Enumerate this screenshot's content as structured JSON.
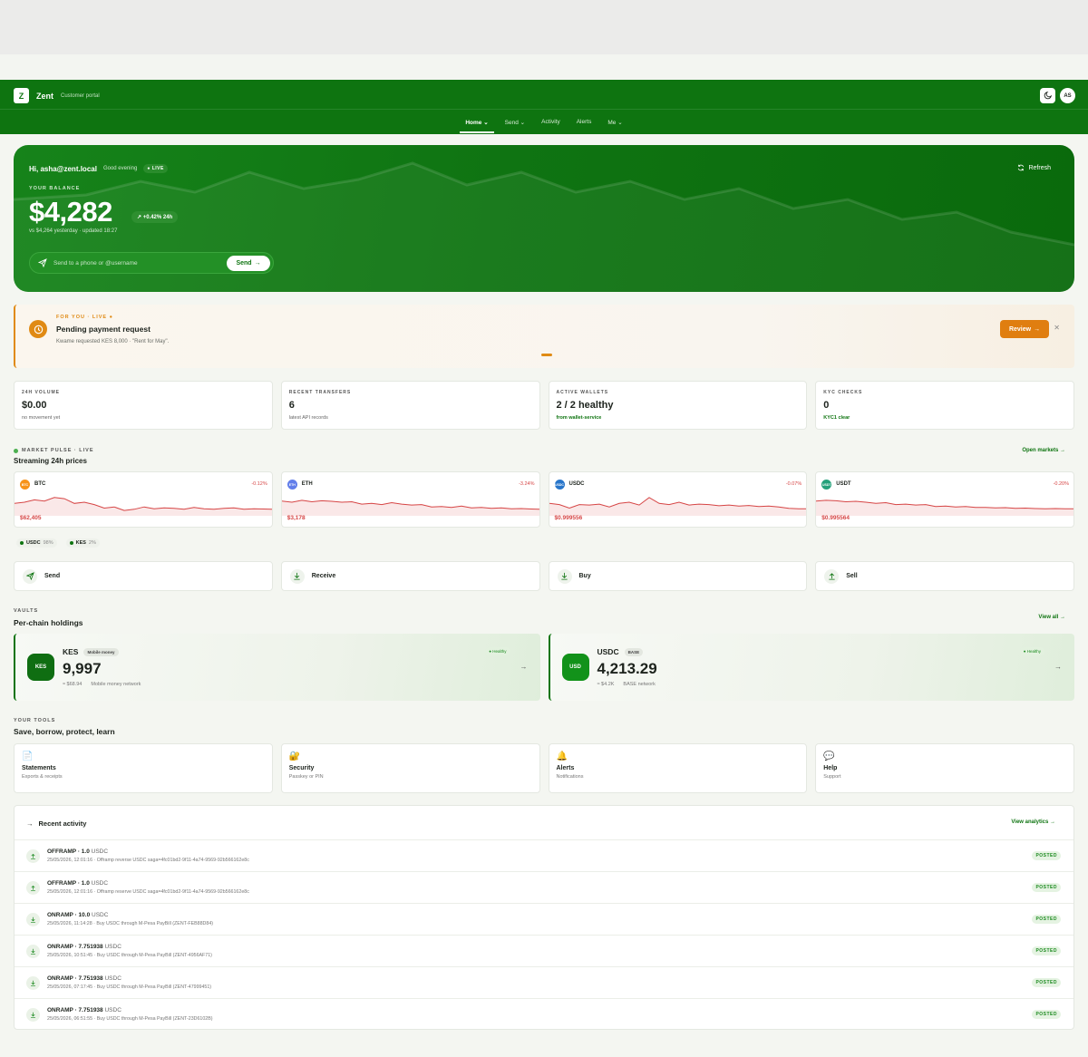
{
  "header": {
    "logo_letter": "Z",
    "brand": "Zent",
    "subtitle": "Customer portal",
    "avatar": "AS",
    "nav": [
      {
        "label": "Home",
        "caret": "⌄"
      },
      {
        "label": "Send",
        "caret": "⌄"
      },
      {
        "label": "Activity",
        "caret": ""
      },
      {
        "label": "Alerts",
        "caret": ""
      },
      {
        "label": "Me",
        "caret": "⌄"
      }
    ]
  },
  "hero": {
    "greeting": "Hi, asha@zent.local",
    "time_of_day": "Good evening",
    "live": "● LIVE",
    "refresh": "Refresh",
    "balance_label": "YOUR BALANCE",
    "balance": "$4,282",
    "change": "↗ +0.42% 24h",
    "meta": "vs $4,264 yesterday · updated 18:27",
    "send_placeholder": "Send to a phone or @username",
    "send_button": "Send"
  },
  "pending": {
    "tag": "FOR YOU · LIVE ●",
    "title": "Pending payment request",
    "text": "Kwame requested KES 8,000 · \"Rent for May\".",
    "review": "Review",
    "close": "✕"
  },
  "stats": [
    {
      "label": "24H VOLUME",
      "value": "$0.00",
      "sub": "no movement yet",
      "green": false
    },
    {
      "label": "RECENT TRANSFERS",
      "value": "6",
      "sub": "latest API records",
      "green": false
    },
    {
      "label": "ACTIVE WALLETS",
      "value": "2 / 2 healthy",
      "sub": "from wallet-service",
      "green": true
    },
    {
      "label": "KYC CHECKS",
      "value": "0",
      "sub": "KYC1 clear",
      "green": true
    }
  ],
  "market": {
    "tag": "MARKET PULSE · LIVE",
    "title": "Streaming 24h prices",
    "open": "Open markets →",
    "tickers": [
      {
        "symbol": "BTC",
        "change": "-0.12%",
        "price": "$62,405",
        "color": "#f7931a",
        "spark": [
          0.55,
          0.5,
          0.4,
          0.45,
          0.3,
          0.35,
          0.55,
          0.5,
          0.6,
          0.75,
          0.7,
          0.85,
          0.8,
          0.7,
          0.78,
          0.74,
          0.76,
          0.8,
          0.72,
          0.78,
          0.8,
          0.76,
          0.74,
          0.8,
          0.78,
          0.79,
          0.8
        ]
      },
      {
        "symbol": "ETH",
        "change": "-3.24%",
        "price": "$3,178",
        "color": "#627eea",
        "spark": [
          0.45,
          0.5,
          0.42,
          0.48,
          0.44,
          0.46,
          0.5,
          0.48,
          0.58,
          0.55,
          0.6,
          0.52,
          0.58,
          0.62,
          0.6,
          0.7,
          0.68,
          0.72,
          0.66,
          0.74,
          0.72,
          0.76,
          0.74,
          0.78,
          0.77,
          0.79,
          0.8
        ]
      },
      {
        "symbol": "USDC",
        "change": "-0.07%",
        "price": "$0.999556",
        "color": "#2775ca",
        "spark": [
          0.55,
          0.6,
          0.75,
          0.6,
          0.62,
          0.58,
          0.7,
          0.55,
          0.5,
          0.62,
          0.3,
          0.55,
          0.6,
          0.5,
          0.62,
          0.58,
          0.6,
          0.65,
          0.62,
          0.66,
          0.64,
          0.68,
          0.66,
          0.7,
          0.76,
          0.78,
          0.78
        ]
      },
      {
        "symbol": "USDT",
        "change": "-0.20%",
        "price": "$0.995564",
        "color": "#26a17b",
        "spark": [
          0.45,
          0.42,
          0.44,
          0.48,
          0.46,
          0.5,
          0.55,
          0.52,
          0.6,
          0.58,
          0.62,
          0.6,
          0.68,
          0.66,
          0.7,
          0.68,
          0.72,
          0.72,
          0.74,
          0.73,
          0.76,
          0.75,
          0.77,
          0.78,
          0.77,
          0.78,
          0.78
        ]
      }
    ],
    "allocation": [
      {
        "label": "USDC",
        "pct": "98%"
      },
      {
        "label": "KES",
        "pct": "2%"
      }
    ]
  },
  "actions": [
    {
      "label": "Send",
      "icon": "send-icon"
    },
    {
      "label": "Receive",
      "icon": "receive-icon"
    },
    {
      "label": "Buy",
      "icon": "buy-icon"
    },
    {
      "label": "Sell",
      "icon": "sell-icon"
    }
  ],
  "vaults": {
    "tag": "VAULTS",
    "title": "Per-chain holdings",
    "view_all": "View all →",
    "items": [
      {
        "badge": "KES",
        "name": "KES",
        "chip": "Mobile money",
        "amount": "9,997",
        "approx": "≈ $68.94",
        "network": "Mobile money network",
        "health": "● Healthy"
      },
      {
        "badge": "USD",
        "name": "USDC",
        "chip": "BASE",
        "amount": "4,213.29",
        "approx": "≈ $4.2K",
        "network": "BASE network",
        "health": "● Healthy"
      }
    ]
  },
  "tools": {
    "tag": "YOUR TOOLS",
    "title": "Save, borrow, protect, learn",
    "items": [
      {
        "emoji": "📄",
        "name": "Statements",
        "sub": "Exports & receipts"
      },
      {
        "emoji": "🔐",
        "name": "Security",
        "sub": "Passkey or PIN"
      },
      {
        "emoji": "🔔",
        "name": "Alerts",
        "sub": "Notifications"
      },
      {
        "emoji": "💬",
        "name": "Help",
        "sub": "Support"
      }
    ]
  },
  "activity": {
    "title": "Recent activity",
    "view": "View analytics →",
    "rows": [
      {
        "dir": "up",
        "type": "OFFRAMP · 1.0",
        "cur": "USDC",
        "sub": "25/05/2026, 12:01:16 · Offramp reverse USDC saga=4fc01bd2-9f11-4a74-9569-92b566162e8c",
        "status": "POSTED"
      },
      {
        "dir": "up",
        "type": "OFFRAMP · 1.0",
        "cur": "USDC",
        "sub": "25/05/2026, 12:01:16 · Offramp reserve USDC saga=4fc01bd2-9f11-4a74-9569-92b566162e8c",
        "status": "POSTED"
      },
      {
        "dir": "down",
        "type": "ONRAMP · 10.0",
        "cur": "USDC",
        "sub": "25/05/2026, 11:14:28 · Buy USDC through M-Pesa PayBill (ZENT-FEB88D84)",
        "status": "POSTED"
      },
      {
        "dir": "down",
        "type": "ONRAMP · 7.751938",
        "cur": "USDC",
        "sub": "25/05/2026, 10:51:45 · Buy USDC through M-Pesa PayBill (ZENT-4956AF71)",
        "status": "POSTED"
      },
      {
        "dir": "down",
        "type": "ONRAMP · 7.751938",
        "cur": "USDC",
        "sub": "25/05/2026, 07:17:45 · Buy USDC through M-Pesa PayBill (ZENT-47999451)",
        "status": "POSTED"
      },
      {
        "dir": "down",
        "type": "ONRAMP · 7.751938",
        "cur": "USDC",
        "sub": "25/05/2026, 06:51:55 · Buy USDC through M-Pesa PayBill (ZENT-23D6102B)",
        "status": "POSTED"
      }
    ]
  }
}
